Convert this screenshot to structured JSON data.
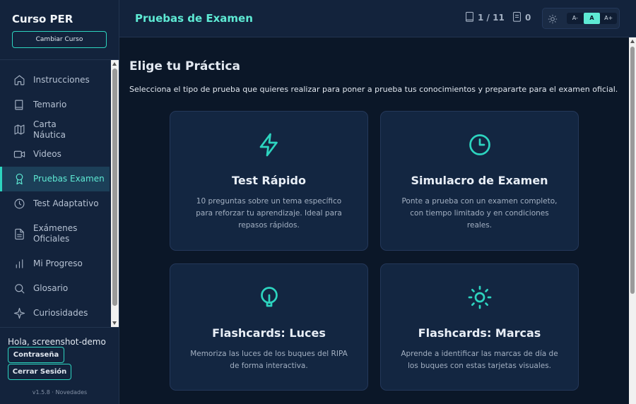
{
  "sidebar": {
    "brand": "Curso PER",
    "change_course": "Cambiar Curso",
    "items": [
      {
        "label": "Instrucciones",
        "icon": "home-icon"
      },
      {
        "label": "Temario",
        "icon": "book-icon"
      },
      {
        "label": "Carta Náutica",
        "icon": "map-icon"
      },
      {
        "label": "Videos",
        "icon": "video-icon"
      },
      {
        "label": "Pruebas Examen",
        "icon": "award-icon",
        "active": true
      },
      {
        "label": "Test Adaptativo",
        "icon": "clock-icon"
      },
      {
        "label": "Exámenes Oficiales",
        "icon": "file-text-icon"
      },
      {
        "label": "Mi Progreso",
        "icon": "bar-chart-icon"
      },
      {
        "label": "Glosario",
        "icon": "search-icon"
      },
      {
        "label": "Curiosidades",
        "icon": "sparkle-icon"
      }
    ],
    "greeting": "Hola, screenshot-demo",
    "password_button": "Contraseña",
    "logout_button": "Cerrar Sesión",
    "version": "v1.5.8 · Novedades"
  },
  "header": {
    "title": "Pruebas de Examen",
    "page_counter": "1 / 11",
    "notes_counter": "0",
    "font_small": "A-",
    "font_normal": "A",
    "font_large": "A+"
  },
  "main": {
    "title": "Elige tu Práctica",
    "subtitle": "Selecciona el tipo de prueba que quieres realizar para poner a prueba tus conocimientos y prepararte para el examen oficial.",
    "cards": [
      {
        "title": "Test Rápido",
        "description": "10 preguntas sobre un tema específico para reforzar tu aprendizaje. Ideal para repasos rápidos.",
        "icon": "lightning-icon"
      },
      {
        "title": "Simulacro de Examen",
        "description": "Ponte a prueba con un examen completo, con tiempo limitado y en condiciones reales.",
        "icon": "clock-icon"
      },
      {
        "title": "Flashcards: Luces",
        "description": "Memoriza las luces de los buques del RIPA de forma interactiva.",
        "icon": "lightbulb-icon"
      },
      {
        "title": "Flashcards: Marcas",
        "description": "Aprende a identificar las marcas de día de los buques con estas tarjetas visuales.",
        "icon": "sun-icon"
      }
    ]
  },
  "colors": {
    "accent": "#2dd4bf",
    "background": "#0b1728",
    "panel": "#13233c"
  }
}
